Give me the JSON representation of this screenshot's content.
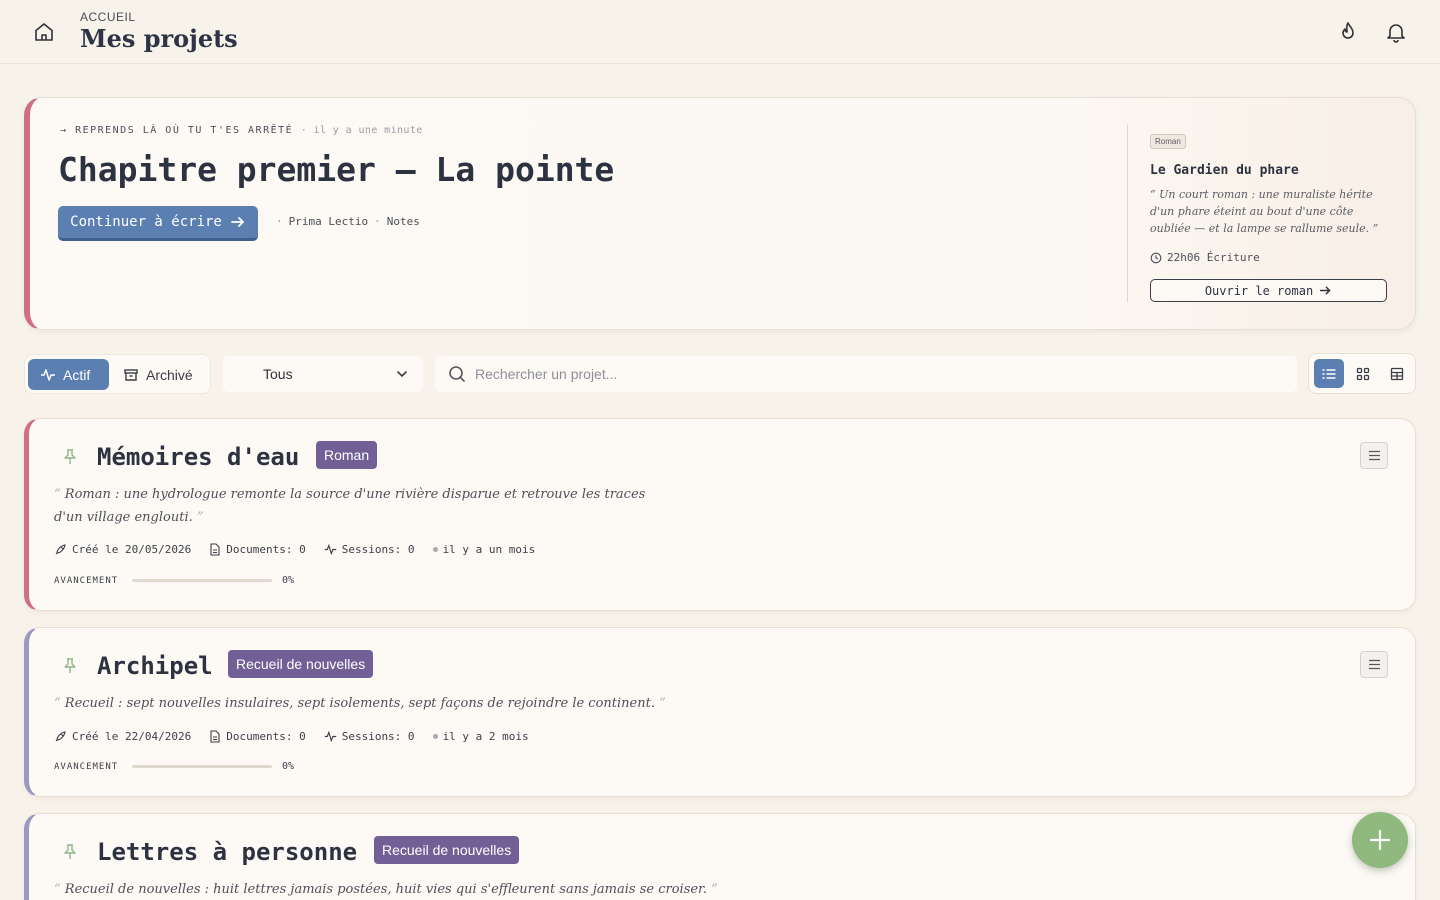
{
  "header": {
    "breadcrumb": "ACCUEIL",
    "title": "Mes projets",
    "icons": [
      "home-icon",
      "flame-icon",
      "bell-icon"
    ]
  },
  "resume": {
    "kicker": "REPRENDS LÀ OÙ TU T'ES ARRÊTÉ",
    "kicker_time": "· il y a une minute",
    "chapter_title": "Chapitre premier — La pointe",
    "continue_label": "Continuer à écrire",
    "meta_1": "Prima Lectio",
    "meta_2": "Notes",
    "project": {
      "genre": "Roman",
      "title": "Le Gardien du phare",
      "description": "“ Un court roman : une muraliste hérite d'un phare éteint au bout d'une côte oubliée — et la lampe se rallume seule. ”",
      "time": "22h06 Écriture",
      "open_label": "Ouvrir le roman"
    }
  },
  "toolbar": {
    "active_label": "Actif",
    "archived_label": "Archivé",
    "filter_value": "Tous",
    "search_placeholder": "Rechercher un projet...",
    "views": [
      "list-view-icon",
      "grid-view-icon",
      "table-view-icon"
    ],
    "selected_view": "list"
  },
  "projects": [
    {
      "title": "Mémoires d'eau",
      "genre": "Roman",
      "description": "Roman : une hydrologue remonte la source d'une rivière disparue et retrouve les traces d'un village englouti.",
      "created": "Créé le 20/05/2026",
      "documents": "Documents: 0",
      "sessions": "Sessions: 0",
      "last_activity": "il y a un mois",
      "progress_label": "AVANCEMENT",
      "progress_text": "0%",
      "progress": 0,
      "accent": "#cf6f84"
    },
    {
      "title": "Archipel",
      "genre": "Recueil de nouvelles",
      "description": "Recueil : sept nouvelles insulaires, sept isolements, sept façons de rejoindre le continent.",
      "created": "Créé le 22/04/2026",
      "documents": "Documents: 0",
      "sessions": "Sessions: 0",
      "last_activity": "il y a 2 mois",
      "progress_label": "AVANCEMENT",
      "progress_text": "0%",
      "progress": 0,
      "accent": "#9d97c2"
    },
    {
      "title": "Lettres à personne",
      "genre": "Recueil de nouvelles",
      "description": "Recueil de nouvelles : huit lettres jamais postées, huit vies qui s'effleurent sans jamais se croiser.",
      "accent": "#9d97c2"
    }
  ],
  "colors": {
    "background": "#f7f2ea",
    "primary": "#5b7fb0",
    "badge": "#725f96",
    "fab": "#8fb97e"
  }
}
